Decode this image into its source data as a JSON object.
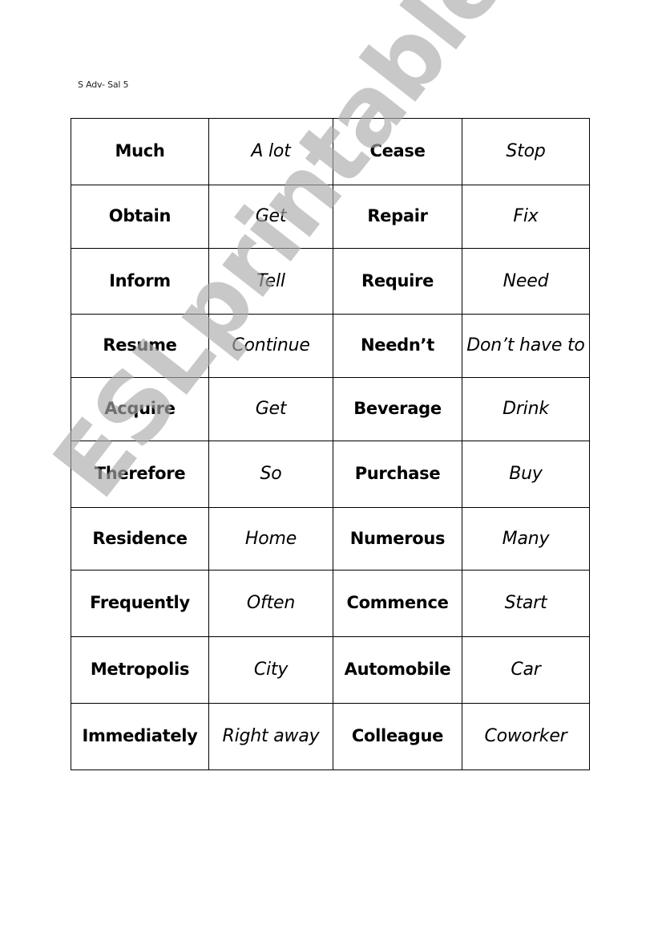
{
  "document": {
    "header_note": "S Adv- Sal 5",
    "watermark": "ESLprintables.com"
  },
  "table": {
    "rows": [
      {
        "word1": "Much",
        "syn1": "A lot",
        "word2": "Cease",
        "syn2": "Stop"
      },
      {
        "word1": "Obtain",
        "syn1": "Get",
        "word2": "Repair",
        "syn2": "Fix"
      },
      {
        "word1": "Inform",
        "syn1": "Tell",
        "word2": "Require",
        "syn2": "Need"
      },
      {
        "word1": "Resume",
        "syn1": "Continue",
        "word2": "Needn’t",
        "syn2": "Don’t have to"
      },
      {
        "word1": "Acquire",
        "syn1": "Get",
        "word2": "Beverage",
        "syn2": "Drink"
      },
      {
        "word1": "Therefore",
        "syn1": "So",
        "word2": "Purchase",
        "syn2": "Buy"
      },
      {
        "word1": "Residence",
        "syn1": "Home",
        "word2": "Numerous",
        "syn2": "Many"
      },
      {
        "word1": "Frequently",
        "syn1": "Often",
        "word2": "Commence",
        "syn2": "Start"
      },
      {
        "word1": "Metropolis",
        "syn1": "City",
        "word2": "Automobile",
        "syn2": "Car"
      },
      {
        "word1": "Immediately",
        "syn1": "Right away",
        "word2": "Colleague",
        "syn2": "Coworker"
      }
    ]
  }
}
